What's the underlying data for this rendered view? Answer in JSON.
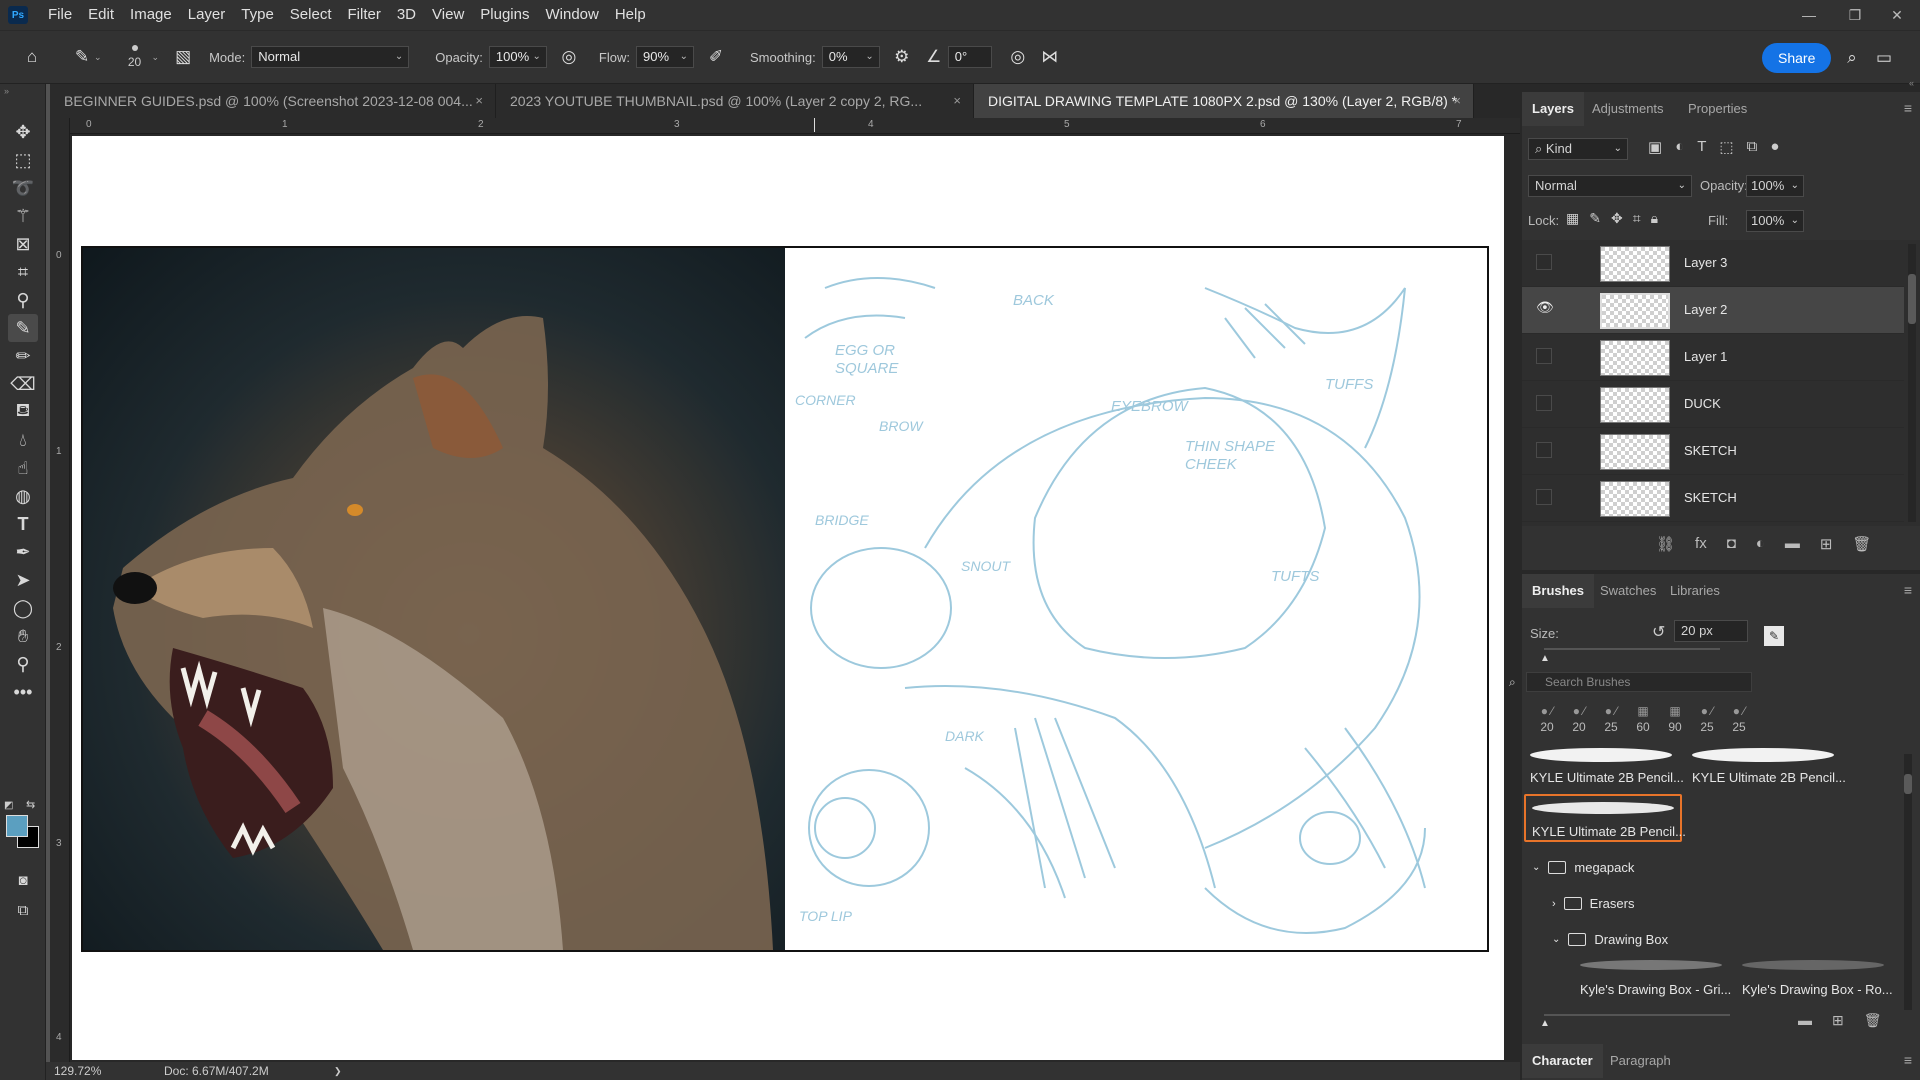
{
  "menubar": {
    "logo": "Ps",
    "items": [
      "File",
      "Edit",
      "Image",
      "Layer",
      "Type",
      "Select",
      "Filter",
      "3D",
      "View",
      "Plugins",
      "Window",
      "Help"
    ]
  },
  "options": {
    "brush_size": "20",
    "mode_label": "Mode:",
    "mode_value": "Normal",
    "opacity_label": "Opacity:",
    "opacity_value": "100%",
    "flow_label": "Flow:",
    "flow_value": "90%",
    "smoothing_label": "Smoothing:",
    "smoothing_value": "0%",
    "angle_value": "0°",
    "share_label": "Share"
  },
  "tabs": [
    {
      "label": "BEGINNER GUIDES.psd @ 100% (Screenshot 2023-12-08 004...",
      "close": "×"
    },
    {
      "label": "2023 YOUTUBE THUMBNAIL.psd @ 100% (Layer 2 copy 2, RG...",
      "close": "×"
    },
    {
      "label": "DIGITAL DRAWING TEMPLATE 1080PX 2.psd @ 130% (Layer 2, RGB/8) *",
      "close": "×"
    }
  ],
  "ruler": {
    "top_ticks": [
      "0",
      "1",
      "2",
      "3",
      "4",
      "5",
      "6",
      "7"
    ],
    "left_ticks": [
      "0",
      "1",
      "2",
      "3",
      "4"
    ]
  },
  "sketch_notes": [
    "BACK",
    "EGG OR SQUARE",
    "CORNER",
    "BROW",
    "EYEBROW",
    "THIN SHAPE CHEEK",
    "TUFFS",
    "TUFTS",
    "BRIDGE",
    "SNOUT",
    "DARK",
    "TOP LIP"
  ],
  "status": {
    "zoom": "129.72%",
    "doc": "Doc: 6.67M/407.2M",
    "arrow": "❯"
  },
  "layers_panel": {
    "tabs": [
      "Layers",
      "Adjustments",
      "Properties"
    ],
    "filter_kind": "Kind",
    "blend_mode": "Normal",
    "opacity_label": "Opacity:",
    "opacity_value": "100%",
    "lock_label": "Lock:",
    "fill_label": "Fill:",
    "fill_value": "100%",
    "layers": [
      {
        "name": "Layer 3",
        "visible": false,
        "selected": false
      },
      {
        "name": "Layer 2",
        "visible": true,
        "selected": true
      },
      {
        "name": "Layer 1",
        "visible": false,
        "selected": false
      },
      {
        "name": "DUCK",
        "visible": false,
        "selected": false
      },
      {
        "name": "SKETCH",
        "visible": false,
        "selected": false
      },
      {
        "name": "SKETCH",
        "visible": false,
        "selected": false
      }
    ]
  },
  "brushes_panel": {
    "tabs": [
      "Brushes",
      "Swatches",
      "Libraries"
    ],
    "size_label": "Size:",
    "size_value": "20 px",
    "search_placeholder": "Search Brushes",
    "recent_sizes": [
      "20",
      "20",
      "25",
      "60",
      "90",
      "25",
      "25"
    ],
    "presets": [
      "KYLE Ultimate 2B Pencil...",
      "KYLE Ultimate 2B Pencil...",
      "KYLE Ultimate 2B Pencil..."
    ],
    "folders": [
      "megapack",
      "Erasers",
      "Drawing Box"
    ],
    "drawing_box_items": [
      "Kyle's Drawing Box - Gri...",
      "Kyle's Drawing Box - Ro..."
    ]
  },
  "bottom_panel": {
    "tabs": [
      "Character",
      "Paragraph"
    ]
  },
  "colors": {
    "accent": "#1473e6",
    "foreground": "#5b9fc0",
    "selection_orange": "#e8742a",
    "sketch_blue": "#8cc0d8"
  }
}
